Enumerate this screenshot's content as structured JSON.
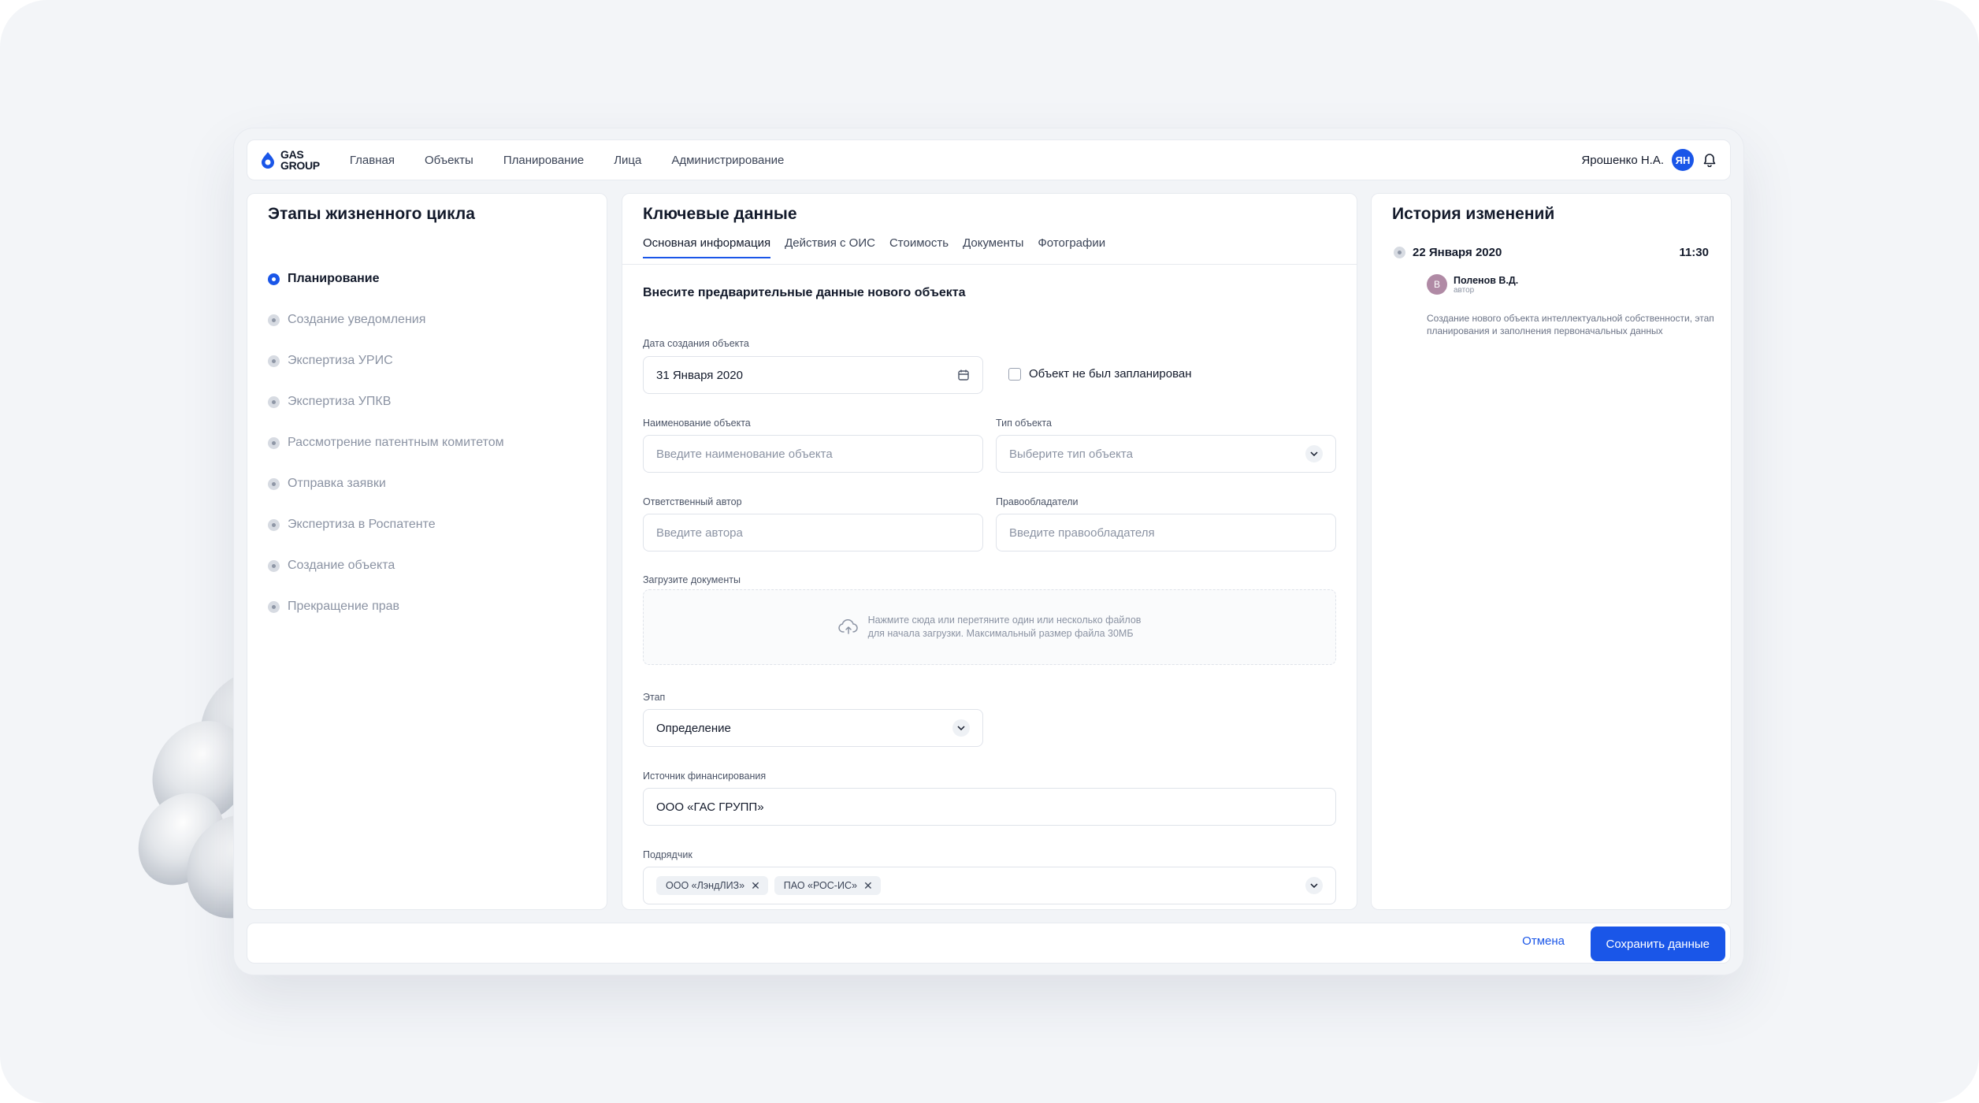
{
  "logo": {
    "line1": "GAS",
    "line2": "GROUP"
  },
  "nav": [
    "Главная",
    "Объекты",
    "Планирование",
    "Лица",
    "Администрирование"
  ],
  "user": {
    "name": "Ярошенко Н.А.",
    "initials": "ЯН"
  },
  "lifecycle": {
    "title": "Этапы жизненного цикла",
    "steps": [
      {
        "label": "Планирование",
        "active": true
      },
      {
        "label": "Создание уведомления",
        "active": false
      },
      {
        "label": "Экспертиза УРИС",
        "active": false
      },
      {
        "label": "Экспертиза УПКВ",
        "active": false
      },
      {
        "label": "Рассмотрение патентным комитетом",
        "active": false
      },
      {
        "label": "Отправка заявки",
        "active": false
      },
      {
        "label": "Экспертиза в Роспатенте",
        "active": false
      },
      {
        "label": "Создание объекта",
        "active": false
      },
      {
        "label": "Прекращение прав",
        "active": false
      }
    ]
  },
  "key_data": {
    "title": "Ключевые данные",
    "tabs": [
      "Основная информация",
      "Действия с ОИС",
      "Стоимость",
      "Документы",
      "Фотографии"
    ],
    "subtitle": "Внесите предварительные данные нового объекта",
    "creation_date": {
      "label": "Дата создания объекта",
      "value": "31 Января 2020"
    },
    "not_planned": {
      "label": "Объект не был запланирован",
      "checked": false
    },
    "object_name": {
      "label": "Наименование объекта",
      "placeholder": "Введите наименование объекта"
    },
    "object_type": {
      "label": "Тип объекта",
      "placeholder": "Выберите тип объекта"
    },
    "author": {
      "label": "Ответственный автор",
      "placeholder": "Введите автора"
    },
    "holders": {
      "label": "Правообладатели",
      "placeholder": "Введите правообладателя"
    },
    "upload": {
      "label": "Загрузите документы",
      "line1": "Нажмите сюда или перетяните один или несколько файлов",
      "line2": "для начала загрузки. Максимальный размер файла 30МБ"
    },
    "stage": {
      "label": "Этап",
      "value": "Определение"
    },
    "funding": {
      "label": "Источник финансирования",
      "value": "ООО «ГАС ГРУПП»"
    },
    "contractor": {
      "label": "Подрядчик",
      "chips": [
        "ООО «ЛэндЛИЗ»",
        "ПАО «РОС-ИС»"
      ]
    }
  },
  "history": {
    "title": "История изменений",
    "entry": {
      "date": "22 Января 2020",
      "time": "11:30",
      "author_initial": "В",
      "author_name": "Поленов В.Д.",
      "author_role": "автор",
      "description": "Создание нового объекта интеллектуальной собственности, этап планирования и заполнения первоначальных данных"
    }
  },
  "footer": {
    "cancel": "Отмена",
    "save": "Сохранить данные"
  },
  "colors": {
    "accent": "#1a56e8",
    "background": "#f3f5f8"
  },
  "icons": [
    "gas-group-logo-icon",
    "notification-bell-icon",
    "calendar-icon",
    "chevron-down-icon",
    "upload-cloud-icon",
    "remove-chip-icon"
  ]
}
